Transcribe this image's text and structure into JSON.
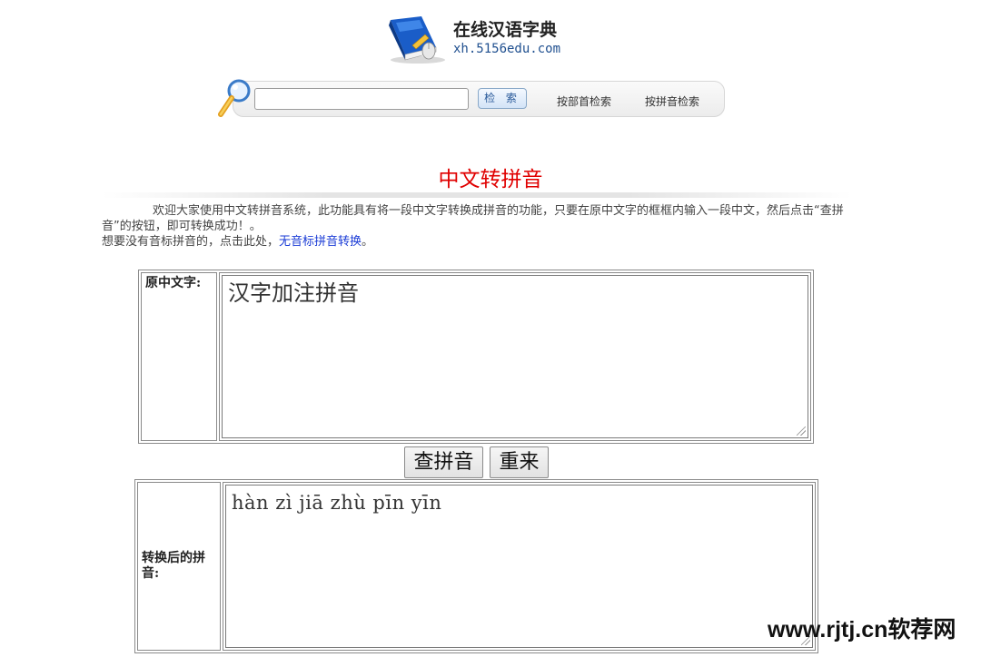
{
  "header": {
    "site_title": "在线汉语字典",
    "site_url": "xh.5156edu.com"
  },
  "search": {
    "input_value": "",
    "button_label": "检 索",
    "nav_links": [
      "按部首检索",
      "按拼音检索"
    ]
  },
  "main": {
    "title": "中文转拼音",
    "intro_line1": "欢迎大家使用中文转拼音系统，此功能具有将一段中文字转换成拼音的功能，只要在原中文字的框框内输入一段中文，然后点击“查拼音”的按钮，即可转换成功！。",
    "intro_line2_prefix": "想要没有音标拼音的，点击此处，",
    "intro_link": "无音标拼音转换",
    "intro_line2_suffix": "。"
  },
  "converter": {
    "source_label": "原中文字:",
    "source_text": "汉字加注拼音",
    "lookup_button": "查拼音",
    "reset_button": "重来",
    "result_label": "转换后的拼音:",
    "result_text": "hàn zì jiā zhù pīn yīn"
  },
  "watermark": "www.rjtj.cn软荐网",
  "icons": {
    "logo": "dictionary-book-icon",
    "search": "magnifier-icon"
  }
}
